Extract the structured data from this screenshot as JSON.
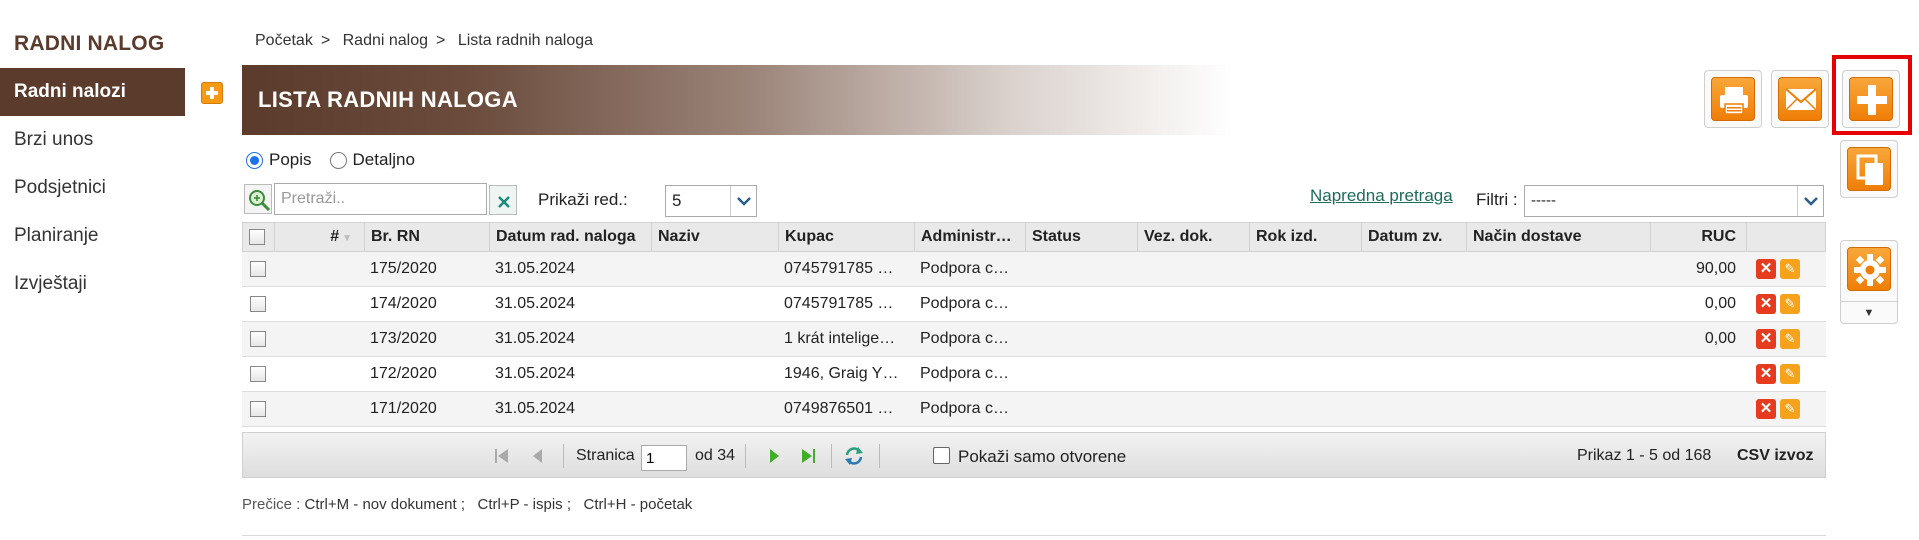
{
  "app": {
    "title": "RADNI NALOG"
  },
  "sidebar": {
    "items": [
      {
        "label": "Radni nalozi",
        "active": true
      },
      {
        "label": "Brzi unos"
      },
      {
        "label": "Podsjetnici"
      },
      {
        "label": "Planiranje"
      },
      {
        "label": "Izvještaji"
      }
    ]
  },
  "breadcrumb": {
    "items": [
      "Početak",
      "Radni nalog",
      "Lista radnih naloga"
    ],
    "separator": ">"
  },
  "page": {
    "title": "LISTA RADNIH NALOGA"
  },
  "view": {
    "options": [
      "Popis",
      "Detaljno"
    ],
    "selected": "Popis"
  },
  "toolbar": {
    "search_placeholder": "Pretraži..",
    "show_rows_label": "Prikaži red.:",
    "rows_value": "5",
    "advanced_search": "Napredna pretraga",
    "filter_label": "Filtri :",
    "filter_value": "-----"
  },
  "table": {
    "columns": [
      "#",
      "Br. RN",
      "Datum rad. naloga",
      "Naziv",
      "Kupac",
      "Administr…",
      "Status",
      "Vez. dok.",
      "Rok izd.",
      "Datum zv.",
      "Način dostave",
      "RUC"
    ],
    "rows": [
      {
        "br_rn": "175/2020",
        "datum": "31.05.2024",
        "naziv": "",
        "kupac": "0745791785 …",
        "admin": "Podpora c…",
        "status": "",
        "vez_dok": "",
        "rok_izd": "",
        "datum_zv": "",
        "nacin_dostave": "",
        "ruc": "90,00"
      },
      {
        "br_rn": "174/2020",
        "datum": "31.05.2024",
        "naziv": "",
        "kupac": "0745791785 …",
        "admin": "Podpora c…",
        "status": "",
        "vez_dok": "",
        "rok_izd": "",
        "datum_zv": "",
        "nacin_dostave": "",
        "ruc": "0,00"
      },
      {
        "br_rn": "173/2020",
        "datum": "31.05.2024",
        "naziv": "",
        "kupac": "1 krát intelige…",
        "admin": "Podpora c…",
        "status": "",
        "vez_dok": "",
        "rok_izd": "",
        "datum_zv": "",
        "nacin_dostave": "",
        "ruc": "0,00"
      },
      {
        "br_rn": "172/2020",
        "datum": "31.05.2024",
        "naziv": "",
        "kupac": "1946, Graig Y…",
        "admin": "Podpora c…",
        "status": "",
        "vez_dok": "",
        "rok_izd": "",
        "datum_zv": "",
        "nacin_dostave": "",
        "ruc": ""
      },
      {
        "br_rn": "171/2020",
        "datum": "31.05.2024",
        "naziv": "",
        "kupac": "0749876501 …",
        "admin": "Podpora c…",
        "status": "",
        "vez_dok": "",
        "rok_izd": "",
        "datum_zv": "",
        "nacin_dostave": "",
        "ruc": ""
      }
    ]
  },
  "pager": {
    "page_label": "Stranica",
    "page_value": "1",
    "of_label": "od 34",
    "only_open_label": "Pokaži samo otvorene",
    "summary": "Prikaz 1 - 5 od 168",
    "csv_label": "CSV izvoz"
  },
  "shortcuts": {
    "label": "Prečice :",
    "text": "Ctrl+M - nov dokument ;   Ctrl+P - ispis ;   Ctrl+H - početak"
  },
  "colors": {
    "brand": "#5b3b2b",
    "accent": "#f59a12",
    "link": "#1f6b5b",
    "highlight": "#e40000"
  },
  "icons": [
    "add-icon",
    "print-icon",
    "mail-icon",
    "copy-icon",
    "gear-icon",
    "search-icon",
    "clear-icon",
    "delete-icon",
    "edit-icon",
    "first-page-icon",
    "prev-page-icon",
    "next-page-icon",
    "last-page-icon",
    "refresh-icon"
  ]
}
